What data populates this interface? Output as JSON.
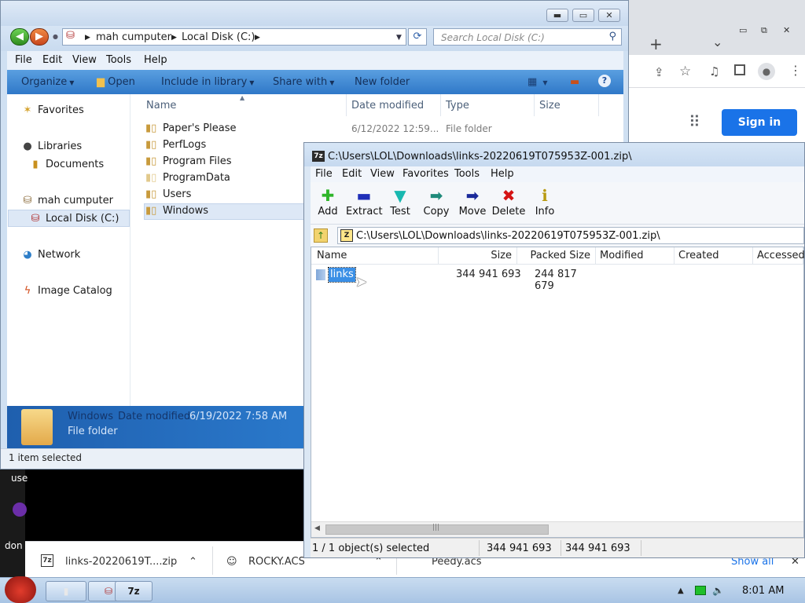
{
  "browser": {
    "window_controls": [
      "▭",
      "⧉",
      "✕"
    ],
    "new_tab_glyph": "+",
    "tab_list_glyph": "⌄",
    "toolbar_icons": [
      "share-icon",
      "star-icon",
      "media-icon",
      "sidepanel-icon",
      "profile-icon",
      "menu-icon"
    ],
    "signin_label": "Sign in",
    "accent": "#1a73e8"
  },
  "explorer": {
    "breadcrumb": [
      "mah cumputer",
      "Local Disk (C:)"
    ],
    "search_placeholder": "Search Local Disk (C:)",
    "menu": [
      "File",
      "Edit",
      "View",
      "Tools",
      "Help"
    ],
    "commands": [
      "Organize",
      "Open",
      "Include in library",
      "Share with",
      "New folder"
    ],
    "nav": {
      "favorites": "Favorites",
      "libraries": "Libraries",
      "documents": "Documents",
      "computer": "mah cumputer",
      "local_disk": "Local Disk (C:)",
      "network": "Network",
      "image_catalog": "Image Catalog"
    },
    "columns": [
      "Name",
      "Date modified",
      "Type",
      "Size"
    ],
    "files": [
      "Paper's Please",
      "PerfLogs",
      "Program Files",
      "ProgramData",
      "Users",
      "Windows"
    ],
    "first_row_date": "6/12/2022 12:59...",
    "first_row_type": "File folder",
    "details": {
      "name": "Windows",
      "date_label": "Date modified:",
      "date_value": "6/19/2022 7:58 AM",
      "type": "File folder"
    },
    "status": "1 item selected"
  },
  "sevenzip": {
    "title": "C:\\Users\\LOL\\Downloads\\links-20220619T075953Z-001.zip\\",
    "menu": [
      "File",
      "Edit",
      "View",
      "Favorites",
      "Tools",
      "Help"
    ],
    "tools": [
      {
        "label": "Add",
        "glyph": "✚",
        "color": "#2fb52a"
      },
      {
        "label": "Extract",
        "glyph": "▬",
        "color": "#1f2fb8"
      },
      {
        "label": "Test",
        "glyph": "▼",
        "color": "#18b8b0"
      },
      {
        "label": "Copy",
        "glyph": "➡",
        "color": "#1e8a7a"
      },
      {
        "label": "Move",
        "glyph": "➡",
        "color": "#1a2a9a"
      },
      {
        "label": "Delete",
        "glyph": "✖",
        "color": "#d41414"
      },
      {
        "label": "Info",
        "glyph": "ℹ",
        "color": "#b89a10"
      }
    ],
    "path": "C:\\Users\\LOL\\Downloads\\links-20220619T075953Z-001.zip\\",
    "columns": [
      "Name",
      "Size",
      "Packed Size",
      "Modified",
      "Created",
      "Accessed"
    ],
    "item": {
      "name": "links",
      "size": "344 941 693",
      "packed": "244 817 679"
    },
    "status": {
      "selected": "1 / 1 object(s) selected",
      "size": "344 941 693",
      "packed": "344 941 693"
    }
  },
  "downloads": {
    "items": [
      "links-20220619T....zip",
      "ROCKY.ACS",
      "Peedy.acs"
    ],
    "show_all": "Show all",
    "close_glyph": "✕"
  },
  "left_strip": [
    "use",
    "don"
  ],
  "taskbar": {
    "clock": "8:01 AM",
    "sevenzip_label": "7z"
  }
}
